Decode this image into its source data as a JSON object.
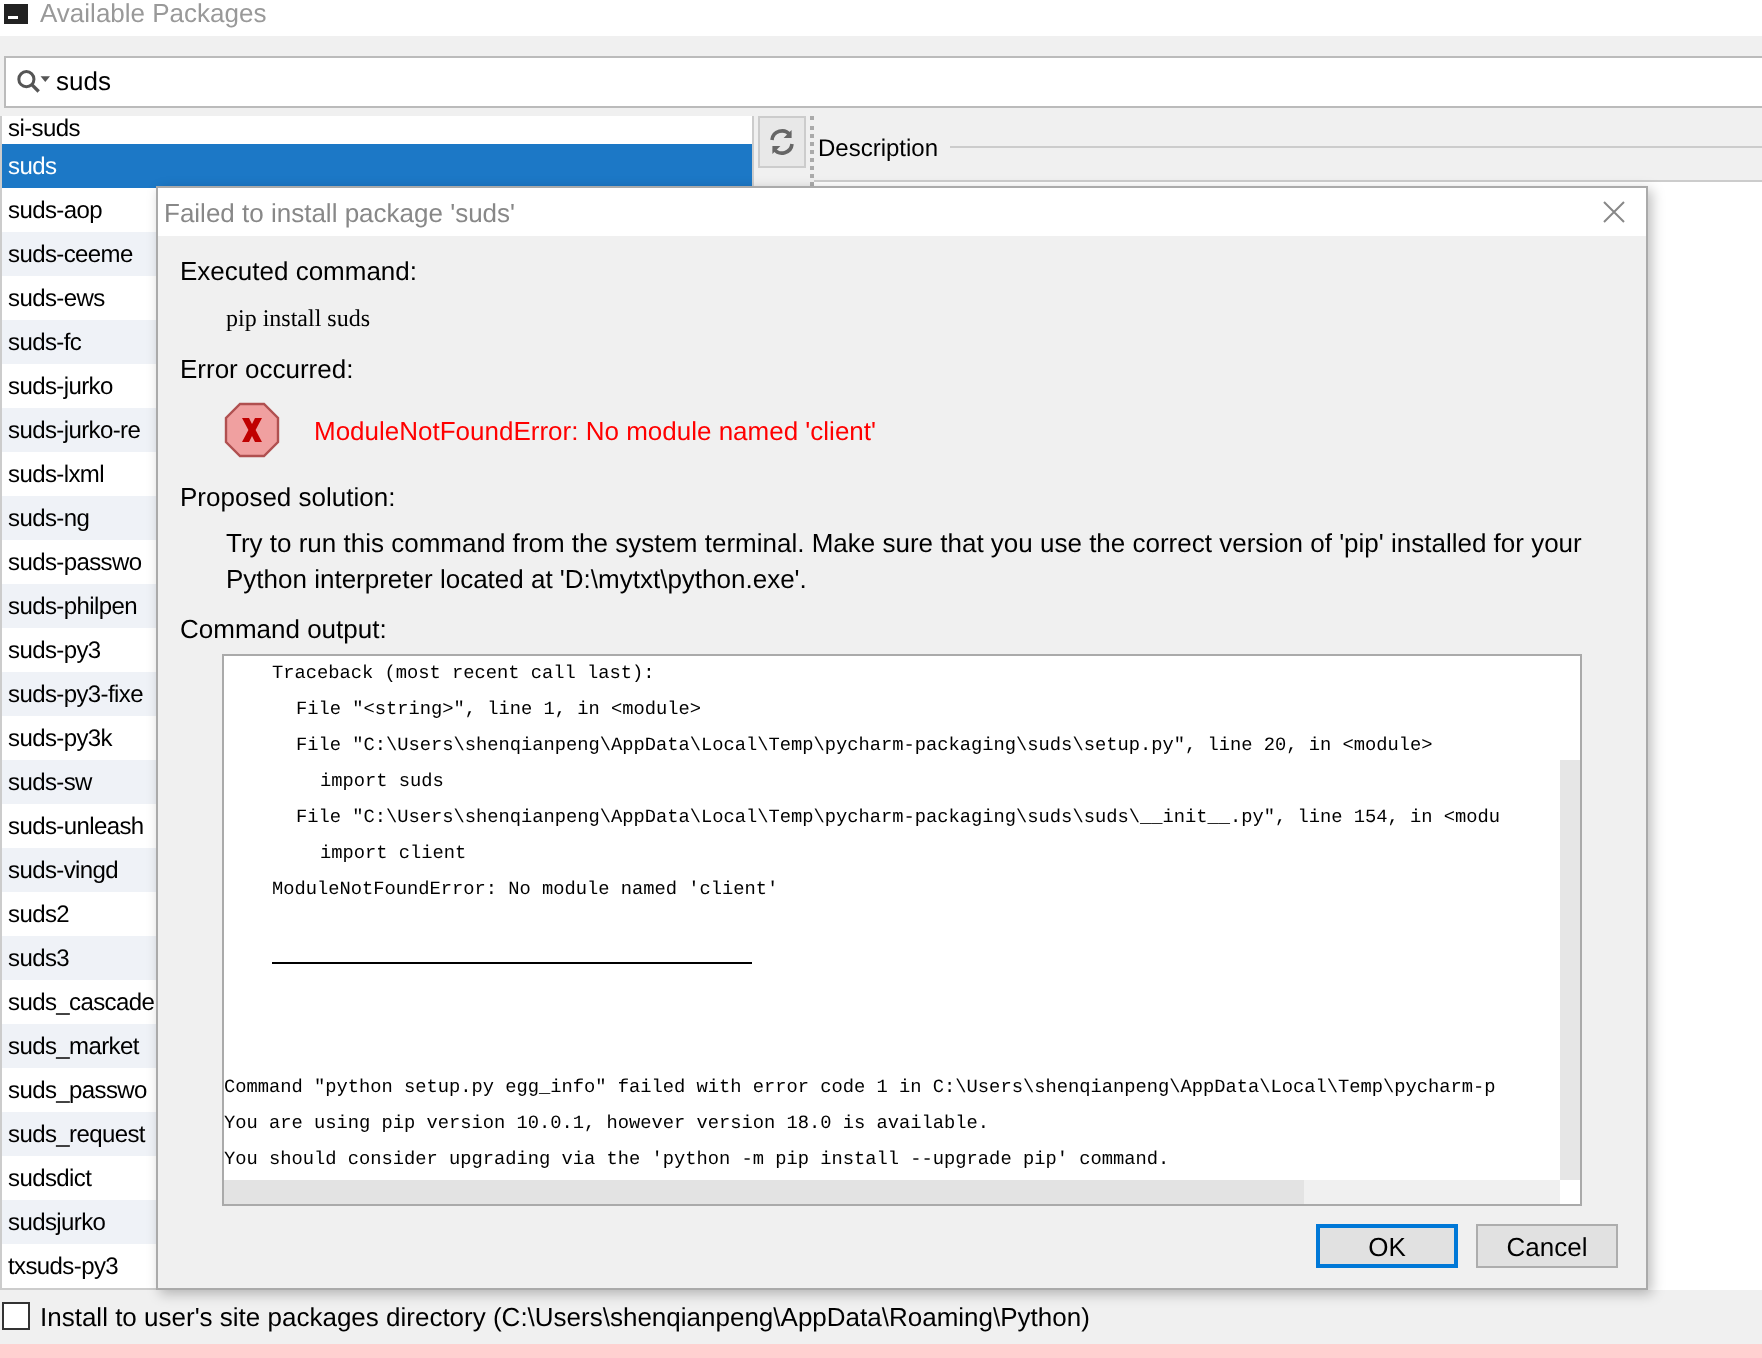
{
  "window": {
    "title": "Available Packages"
  },
  "search": {
    "value": "suds"
  },
  "packages": [
    {
      "name": "si-suds",
      "selected": false
    },
    {
      "name": "suds",
      "selected": true
    },
    {
      "name": "suds-aop",
      "selected": false
    },
    {
      "name": "suds-ceeme",
      "selected": false
    },
    {
      "name": "suds-ews",
      "selected": false
    },
    {
      "name": "suds-fc",
      "selected": false
    },
    {
      "name": "suds-jurko",
      "selected": false
    },
    {
      "name": "suds-jurko-re",
      "selected": false
    },
    {
      "name": "suds-lxml",
      "selected": false
    },
    {
      "name": "suds-ng",
      "selected": false
    },
    {
      "name": "suds-passwo",
      "selected": false
    },
    {
      "name": "suds-philpen",
      "selected": false
    },
    {
      "name": "suds-py3",
      "selected": false
    },
    {
      "name": "suds-py3-fixe",
      "selected": false
    },
    {
      "name": "suds-py3k",
      "selected": false
    },
    {
      "name": "suds-sw",
      "selected": false
    },
    {
      "name": "suds-unleash",
      "selected": false
    },
    {
      "name": "suds-vingd",
      "selected": false
    },
    {
      "name": "suds2",
      "selected": false
    },
    {
      "name": "suds3",
      "selected": false
    },
    {
      "name": "suds_cascade",
      "selected": false
    },
    {
      "name": "suds_market",
      "selected": false
    },
    {
      "name": "suds_passwo",
      "selected": false
    },
    {
      "name": "suds_request",
      "selected": false
    },
    {
      "name": "sudsdict",
      "selected": false
    },
    {
      "name": "sudsjurko",
      "selected": false
    },
    {
      "name": "txsuds-py3",
      "selected": false
    }
  ],
  "description": {
    "header": "Description"
  },
  "install_option": {
    "label": "Install to user's site packages directory (C:\\Users\\shenqianpeng\\AppData\\Roaming\\Python)",
    "checked": false
  },
  "dialog": {
    "title": "Failed to install package 'suds'",
    "executed_label": "Executed command:",
    "command": "pip install suds",
    "error_label": "Error occurred:",
    "error_message": "ModuleNotFoundError: No module named 'client'",
    "solution_label": "Proposed solution:",
    "solution": "Try to run this command from the system terminal. Make sure that you use the correct version of 'pip' installed for your Python interpreter located at 'D:\\mytxt\\python.exe'.",
    "output_label": "Command output:",
    "output_lines": [
      {
        "kind": "traceback",
        "text": "Traceback (most recent call last):"
      },
      {
        "kind": "frame",
        "text": "File \"<string>\", line 1, in <module>"
      },
      {
        "kind": "frame",
        "text": "File \"C:\\Users\\shenqianpeng\\AppData\\Local\\Temp\\pycharm-packaging\\suds\\setup.py\", line 20, in <module>"
      },
      {
        "kind": "source",
        "text": "import suds"
      },
      {
        "kind": "frame",
        "text": "File \"C:\\Users\\shenqianpeng\\AppData\\Local\\Temp\\pycharm-packaging\\suds\\suds\\__init__.py\", line 154, in <modu"
      },
      {
        "kind": "source",
        "text": "import client"
      },
      {
        "kind": "traceback",
        "text": "ModuleNotFoundError: No module named 'client'"
      },
      {
        "kind": "blank"
      },
      {
        "kind": "rule"
      },
      {
        "kind": "blank"
      },
      {
        "kind": "blank"
      },
      {
        "kind": "message",
        "text": "Command \"python setup.py egg_info\" failed with error code 1 in C:\\Users\\shenqianpeng\\AppData\\Local\\Temp\\pycharm-p"
      },
      {
        "kind": "message",
        "text": "You are using pip version 10.0.1, however version 18.0 is available."
      },
      {
        "kind": "message",
        "text": "You should consider upgrading via the 'python -m pip install --upgrade pip' command."
      }
    ],
    "buttons": [
      {
        "label": "OK",
        "default": true
      },
      {
        "label": "Cancel",
        "default": false
      }
    ]
  }
}
